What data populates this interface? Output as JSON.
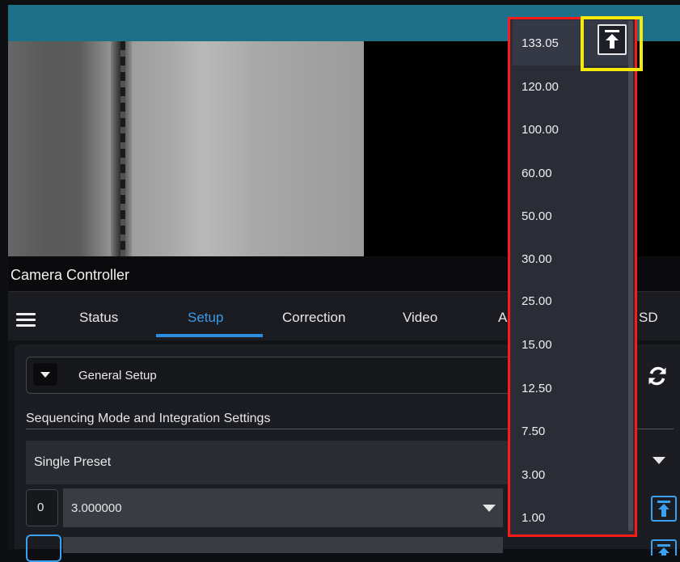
{
  "window": {
    "title": "Camera Controller"
  },
  "tabs": [
    {
      "label": "Status"
    },
    {
      "label": "Setup"
    },
    {
      "label": "Correction"
    },
    {
      "label": "Video"
    }
  ],
  "tabs_partial": {
    "left_letter": "A",
    "right_letters": "SD"
  },
  "setup": {
    "section_dropdown": "General Setup",
    "section_heading": "Sequencing Mode and Integration Settings",
    "mode_select": "Single Preset",
    "preset_index": "0",
    "integration_value": "3.000000"
  },
  "frame_rate_list": {
    "items": [
      "133.05",
      "120.00",
      "100.00",
      "60.00",
      "50.00",
      "30.00",
      "25.00",
      "15.00",
      "12.50",
      "7.50",
      "3.00",
      "1.00"
    ]
  },
  "colors": {
    "accent": "#2d8ee0",
    "header": "#1e6f8a",
    "highlight_red": "#ff1a1a",
    "highlight_yellow": "#f3ea0a"
  },
  "icons": {
    "menu": "hamburger-icon",
    "refresh": "refresh-icon",
    "scroll_top": "arrow-to-top-icon",
    "dropdown": "caret-down-icon"
  }
}
